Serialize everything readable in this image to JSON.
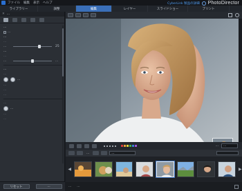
{
  "app": {
    "menu": [
      "ファイル",
      "編集",
      "表示",
      "ヘルプ"
    ],
    "link": "CyberLink 製品の詳細",
    "name": "PhotoDirector",
    "accent_color": "#3a6fb8",
    "badge_left": "...",
    "badge_right": "..."
  },
  "tabs": [
    {
      "label": "ライブラリー",
      "active": false
    },
    {
      "label": "調整",
      "active": false
    },
    {
      "label": "編集",
      "active": true
    },
    {
      "label": "レイヤー",
      "active": false
    },
    {
      "label": "スライドショー",
      "active": false
    },
    {
      "label": "プリント",
      "active": false
    }
  ],
  "left_panel": {
    "title": "...",
    "close_icon": "close-icon",
    "tools": [
      "wrinkle-tool-icon",
      "eye-tool-icon",
      "eye-bag-tool-icon",
      "teeth-tool-icon",
      "more-tool-icon"
    ],
    "section1_title": "...",
    "option_checkbox": "...",
    "sub1_title": "...",
    "sub1_desc": "...",
    "slider1": {
      "label": "...",
      "value": "25",
      "percent": 70
    },
    "sub2_title": "...",
    "sub2_desc": "...",
    "slider2": {
      "label": "...",
      "value": "...",
      "percent": 50
    },
    "section2_title": "...",
    "section2_desc": "...",
    "brush_title": "...",
    "brush_rows": [
      "...",
      "...",
      "..."
    ],
    "section3_desc": "...",
    "brush2_title": "...",
    "brush2_rows": [
      "...",
      "..."
    ],
    "footer_buttons": [
      "リセット",
      "...",
      "..."
    ]
  },
  "viewer": {
    "zoom_label": "...",
    "zoom_value": "...",
    "filter_label": "...",
    "filter_select": "...",
    "status_count": "...",
    "status_path": "...",
    "color_labels": [
      "#d93b3b",
      "#e8a23a",
      "#e6d33a",
      "#3fb24f",
      "#3a7fd9",
      "#9a55d6"
    ]
  },
  "filmstrip": {
    "items": 8,
    "selected_index": 4
  }
}
